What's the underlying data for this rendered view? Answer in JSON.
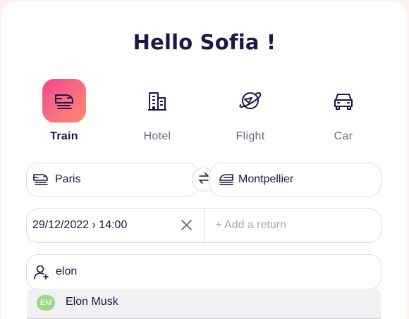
{
  "greeting": "Hello Sofia !",
  "modes": [
    {
      "label": "Train",
      "icon": "train-icon",
      "active": true
    },
    {
      "label": "Hotel",
      "icon": "hotel-icon",
      "active": false
    },
    {
      "label": "Flight",
      "icon": "flight-icon",
      "active": false
    },
    {
      "label": "Car",
      "icon": "car-icon",
      "active": false
    }
  ],
  "origin": {
    "value": "Paris",
    "icon": "train-front-icon"
  },
  "destination": {
    "value": "Montpellier",
    "icon": "train-side-icon"
  },
  "swap_icon": "swap-arrows-icon",
  "outbound": {
    "value": "29/12/2022 › 14:00",
    "clear_icon": "close-icon"
  },
  "return_placeholder": "+ Add a return",
  "passenger": {
    "value": "elon",
    "icon": "add-user-icon"
  },
  "suggestions": [
    {
      "initials": "EM",
      "name": "Elon Musk"
    }
  ],
  "colors": {
    "accent_gradient": [
      "#f0458f",
      "#fc8a64"
    ],
    "text_dark": "#1d1646",
    "text_muted": "#6b6782",
    "avatar_green": "#9ad98a",
    "background": "#fdf1f2"
  }
}
